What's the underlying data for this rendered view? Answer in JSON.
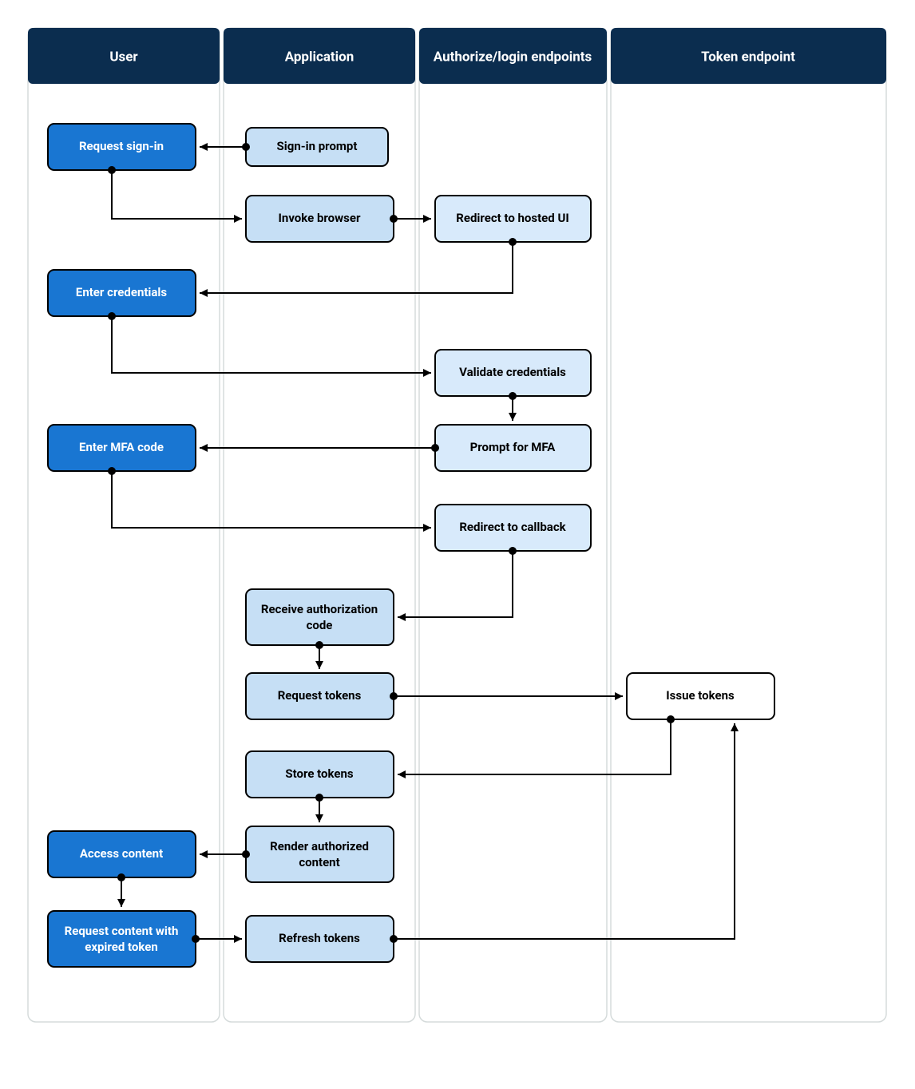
{
  "lanes": {
    "user": {
      "title": "User"
    },
    "application": {
      "title": "Application"
    },
    "authorize": {
      "title": "Authorize/login endpoints"
    },
    "token": {
      "title": "Token endpoint"
    }
  },
  "nodes": {
    "request_sign_in": {
      "label": "Request sign-in"
    },
    "sign_in_prompt": {
      "label": "Sign-in prompt"
    },
    "invoke_browser": {
      "label": "Invoke browser"
    },
    "redirect_hosted": {
      "label": "Redirect to hosted UI"
    },
    "enter_credentials": {
      "label": "Enter credentials"
    },
    "validate_credentials": {
      "label": "Validate credentials"
    },
    "enter_mfa": {
      "label": "Enter MFA code"
    },
    "prompt_mfa": {
      "label": "Prompt for MFA"
    },
    "redirect_callback": {
      "label": "Redirect to callback"
    },
    "receive_code_l1": {
      "label": "Receive authorization"
    },
    "receive_code_l2": {
      "label": "code"
    },
    "request_tokens": {
      "label": "Request tokens"
    },
    "issue_tokens": {
      "label": "Issue tokens"
    },
    "store_tokens": {
      "label": "Store tokens"
    },
    "render_l1": {
      "label": "Render authorized"
    },
    "render_l2": {
      "label": "content"
    },
    "access_content": {
      "label": "Access content"
    },
    "request_expired_l1": {
      "label": "Request content with"
    },
    "request_expired_l2": {
      "label": "expired token"
    },
    "refresh_tokens": {
      "label": "Refresh tokens"
    }
  }
}
